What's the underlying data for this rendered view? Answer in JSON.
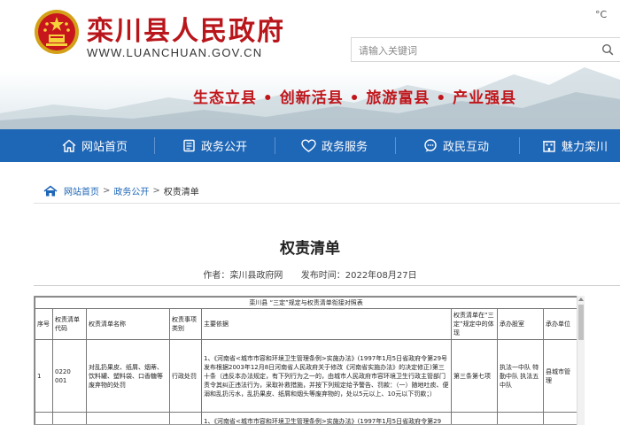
{
  "header": {
    "title": "栾川县人民政府",
    "url": "WWW.LUANCHUAN.GOV.CN",
    "search_placeholder": "请输入关键词",
    "weather": "°C",
    "slogan": "生态立县 • 创新活县 • 旅游富县 • 产业强县"
  },
  "nav": {
    "items": [
      {
        "label": "网站首页",
        "icon": "home-icon"
      },
      {
        "label": "政务公开",
        "icon": "document-icon"
      },
      {
        "label": "政务服务",
        "icon": "heart-icon"
      },
      {
        "label": "政民互动",
        "icon": "chat-icon"
      },
      {
        "label": "魅力栾川",
        "icon": "building-icon"
      }
    ]
  },
  "breadcrumb": {
    "items": [
      "网站首页",
      "政务公开",
      "权责清单"
    ],
    "separator": ">"
  },
  "article": {
    "title": "权责清单",
    "author": "作者：栾川县政府网",
    "publish_time": "发布时间：2022年08月27日"
  },
  "table": {
    "caption": "栾川县 “三定”规定与权责清单衔接对照表",
    "headers": [
      "序号",
      "权责清单代码",
      "权责清单名称",
      "权责事项类别",
      "主要依据",
      "权责清单在“三定”规定中的体现",
      "承办股室",
      "承办单位"
    ],
    "rows": [
      {
        "no": "1",
        "code": "0220 001",
        "name": "对乱扔果皮、纸屑、烟蒂、饮料罐、塑料袋、口香糖等废弃物的处罚",
        "type": "行政处罚",
        "basis": "1、《河南省<城市市容和环境卫生管理条例>实施办法》(1997年1月5日省政府令第29号发布根据2003年12月8日河南省人民政府关于修改《河南省实施办法》的决定修正)第三十条（违反本办法规定，有下列行为之一的，由城市人民政府市容环境卫生行政主管部门责令其纠正违法行为，采取补救措施，并按下列规定给予警告、罚款：（一）随地吐痰、便溺和乱扔污水，乱扔果皮、纸屑和烟头等废弃物的，处以5元以上、10元以下罚款；）",
        "reflection": "第三条第七项",
        "dept": "执法一中队 特勤中队 执法五中队",
        "unit": "县城市管理"
      },
      {
        "no": "",
        "code": "",
        "name": "",
        "type": "",
        "basis": "1、《河南省<城市市容和环境卫生管理条例>实施办法》(1997年1月5日省政府令第29",
        "reflection": "",
        "dept": "",
        "unit": ""
      }
    ]
  },
  "colors": {
    "brand_red": "#b8161b",
    "nav_blue": "#1e66b6",
    "link_blue": "#1e66b6"
  }
}
